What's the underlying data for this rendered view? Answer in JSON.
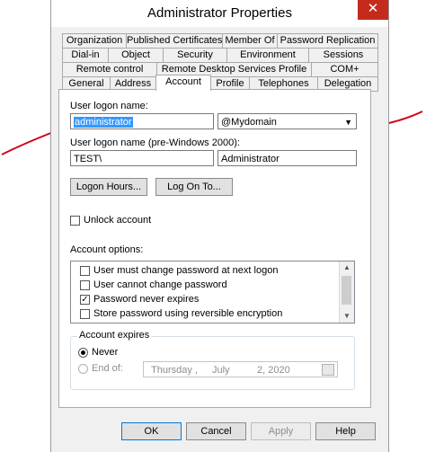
{
  "window": {
    "title": "Administrator Properties",
    "close_icon": "✕"
  },
  "tabs_row1": [
    "Organization",
    "Published Certificates",
    "Member Of",
    "Password Replication"
  ],
  "tabs_row2": [
    "Dial-in",
    "Object",
    "Security",
    "Environment",
    "Sessions"
  ],
  "tabs_row3": [
    "Remote control",
    "Remote Desktop Services Profile",
    "COM+"
  ],
  "tabs_row4": [
    "General",
    "Address",
    "Account",
    "Profile",
    "Telephones",
    "Delegation"
  ],
  "active_tab": "Account",
  "account": {
    "logon_name_label": "User logon name:",
    "logon_name_value": "administrator",
    "domain_value": "@Mydomain",
    "pre2000_label": "User logon name (pre-Windows 2000):",
    "pre2000_domain": "TEST\\",
    "pre2000_name": "Administrator",
    "logon_hours_button": "Logon Hours...",
    "log_on_to_button": "Log On To...",
    "unlock_label": "Unlock account",
    "options_label": "Account options:",
    "options": [
      {
        "label": "User must change password at next logon",
        "checked": false
      },
      {
        "label": "User cannot change password",
        "checked": false
      },
      {
        "label": "Password never expires",
        "checked": true
      },
      {
        "label": "Store password using reversible encryption",
        "checked": false
      }
    ],
    "expires_label": "Account expires",
    "never_label": "Never",
    "end_of_label": "End of:",
    "date": {
      "weekday": "Thursday ,",
      "month": "July",
      "day": "2, 2020"
    }
  },
  "buttons": {
    "ok": "OK",
    "cancel": "Cancel",
    "apply": "Apply",
    "help": "Help"
  },
  "colors": {
    "annotation_arrow": "#d0021b",
    "selection": "#3399ff",
    "close_button": "#c42b1c"
  }
}
